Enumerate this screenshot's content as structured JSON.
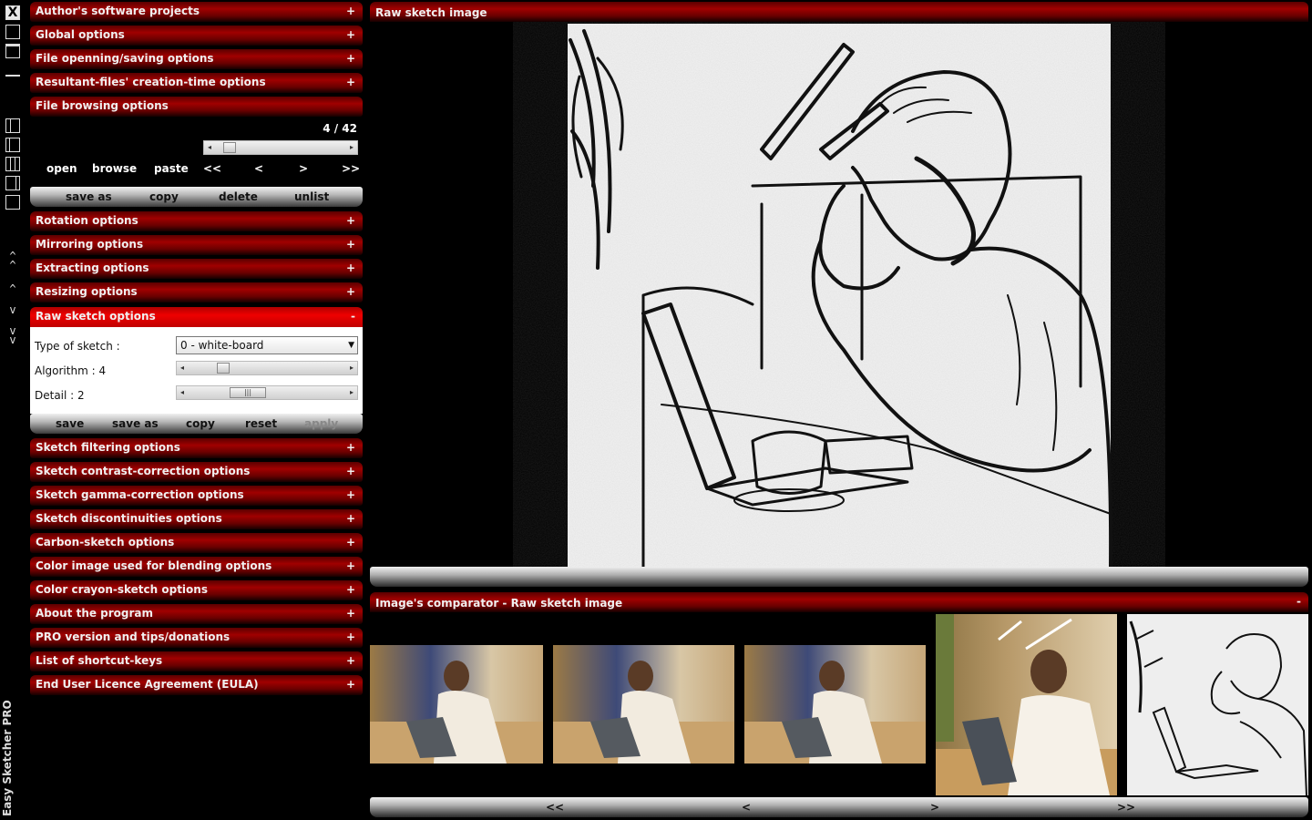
{
  "app_title": "Easy Sketcher PRO",
  "toolbar": {
    "close_label": "X"
  },
  "panels": [
    {
      "label": "Author's software projects",
      "state": "+"
    },
    {
      "label": "Global options",
      "state": "+"
    },
    {
      "label": "File openning/saving options",
      "state": "+"
    },
    {
      "label": "Resultant-files' creation-time options",
      "state": "+"
    },
    {
      "label": "File browsing options",
      "state": ""
    },
    {
      "label": "Rotation options",
      "state": "+"
    },
    {
      "label": "Mirroring options",
      "state": "+"
    },
    {
      "label": "Extracting options",
      "state": "+"
    },
    {
      "label": "Resizing options",
      "state": "+"
    },
    {
      "label": "Raw sketch options",
      "state": "-"
    },
    {
      "label": "Sketch filtering options",
      "state": "+"
    },
    {
      "label": "Sketch contrast-correction options",
      "state": "+"
    },
    {
      "label": "Sketch gamma-correction options",
      "state": "+"
    },
    {
      "label": "Sketch discontinuities options",
      "state": "+"
    },
    {
      "label": "Carbon-sketch options",
      "state": "+"
    },
    {
      "label": "Color image used for blending options",
      "state": "+"
    },
    {
      "label": "Color crayon-sketch options",
      "state": "+"
    },
    {
      "label": "About the program",
      "state": "+"
    },
    {
      "label": "PRO version and tips/donations",
      "state": "+"
    },
    {
      "label": "List of shortcut-keys",
      "state": "+"
    },
    {
      "label": "End User Licence Agreement (EULA)",
      "state": "+"
    }
  ],
  "file_browsing": {
    "counter": "4 / 42",
    "position": 0.07,
    "buttons": [
      "open",
      "browse",
      "paste",
      "<<",
      "<",
      ">",
      ">>"
    ],
    "actions": [
      "save as",
      "copy",
      "delete",
      "unlist"
    ]
  },
  "raw_sketch": {
    "type_label": "Type of sketch :",
    "type_value": "0 - white-board",
    "algorithm_label": "Algorithm : 4",
    "algorithm_value": 4,
    "detail_label": "Detail : 2",
    "detail_value": 2,
    "actions": [
      "save",
      "save as",
      "copy",
      "reset",
      "apply"
    ]
  },
  "main_view": {
    "title": "Raw sketch image"
  },
  "comparator": {
    "title": "Image's comparator - Raw sketch image",
    "state": "-",
    "nav": [
      "<<",
      "<",
      ">",
      ">>"
    ]
  },
  "colors": {
    "header_red": "#a00000",
    "open_red": "#ee0000",
    "bar_gray": "#b0b0b0"
  }
}
